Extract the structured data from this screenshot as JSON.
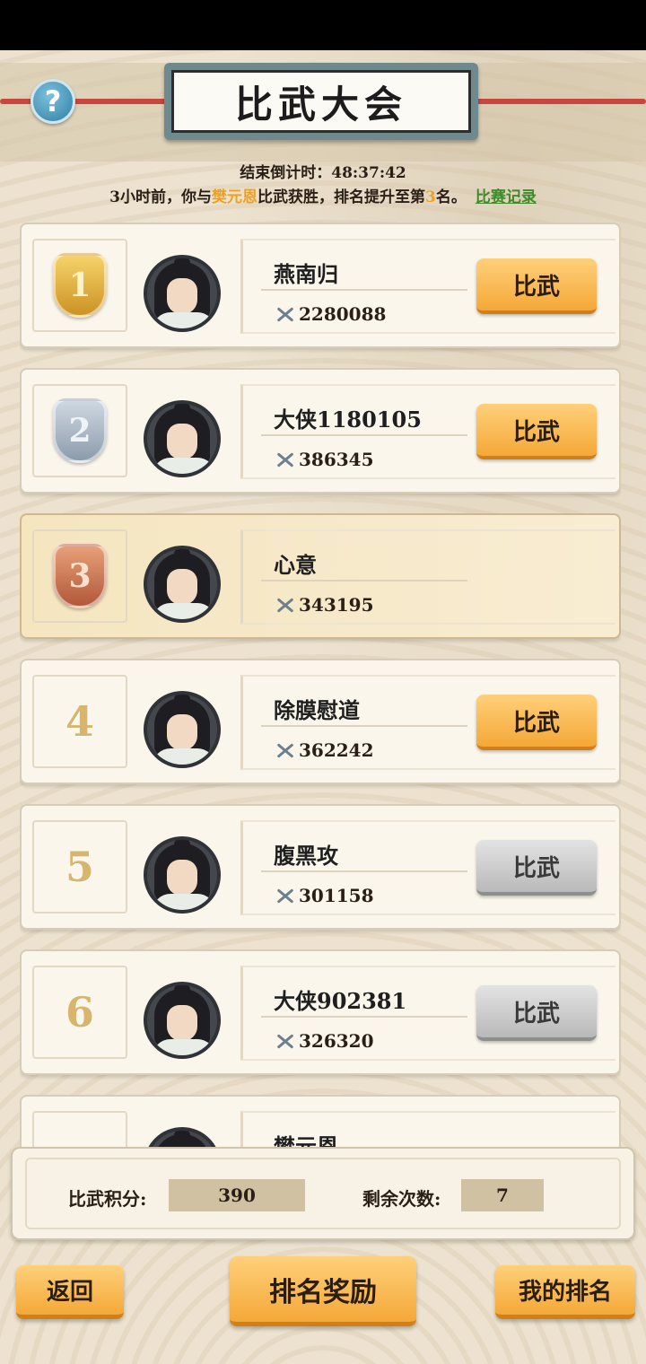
{
  "title": "比武大会",
  "countdown": {
    "label": "结束倒计时：",
    "value": "48:37:42"
  },
  "notice": {
    "prefix": "3小时前，你与",
    "opponent": "樊元恩",
    "middle": "比武获胜，排名提升至第",
    "rank": "3",
    "suffix": "名。",
    "record_link": "比赛记录"
  },
  "players": [
    {
      "rank": "1",
      "medal": "gold",
      "name": "燕南归",
      "power": "2280088",
      "button": "比武",
      "enabled": true
    },
    {
      "rank": "2",
      "medal": "silver",
      "name": "大侠1180105",
      "power": "386345",
      "button": "比武",
      "enabled": true
    },
    {
      "rank": "3",
      "medal": "bronze",
      "name": "心意",
      "power": "343195",
      "button": "",
      "enabled": false,
      "is_me": true
    },
    {
      "rank": "4",
      "name": "除膜慰道",
      "power": "362242",
      "button": "比武",
      "enabled": true
    },
    {
      "rank": "5",
      "name": "腹黑攻",
      "power": "301158",
      "button": "比武",
      "enabled": false
    },
    {
      "rank": "6",
      "name": "大侠902381",
      "power": "326320",
      "button": "比武",
      "enabled": false
    },
    {
      "rank": "",
      "name": "樊元恩",
      "power": "",
      "button": "",
      "enabled": false
    }
  ],
  "score": {
    "points_label": "比武积分:",
    "points_value": "390",
    "remaining_label": "剩余次数:",
    "remaining_value": "7"
  },
  "bottom": {
    "back": "返回",
    "rewards": "排名奖励",
    "my_rank": "我的排名"
  },
  "help_icon": "question-mark-icon",
  "colors": {
    "accent_orange": "#f4a838",
    "highlight_name": "#f0a020",
    "record_link": "#3f8a2a",
    "disabled_button": "#b9b9b9"
  }
}
